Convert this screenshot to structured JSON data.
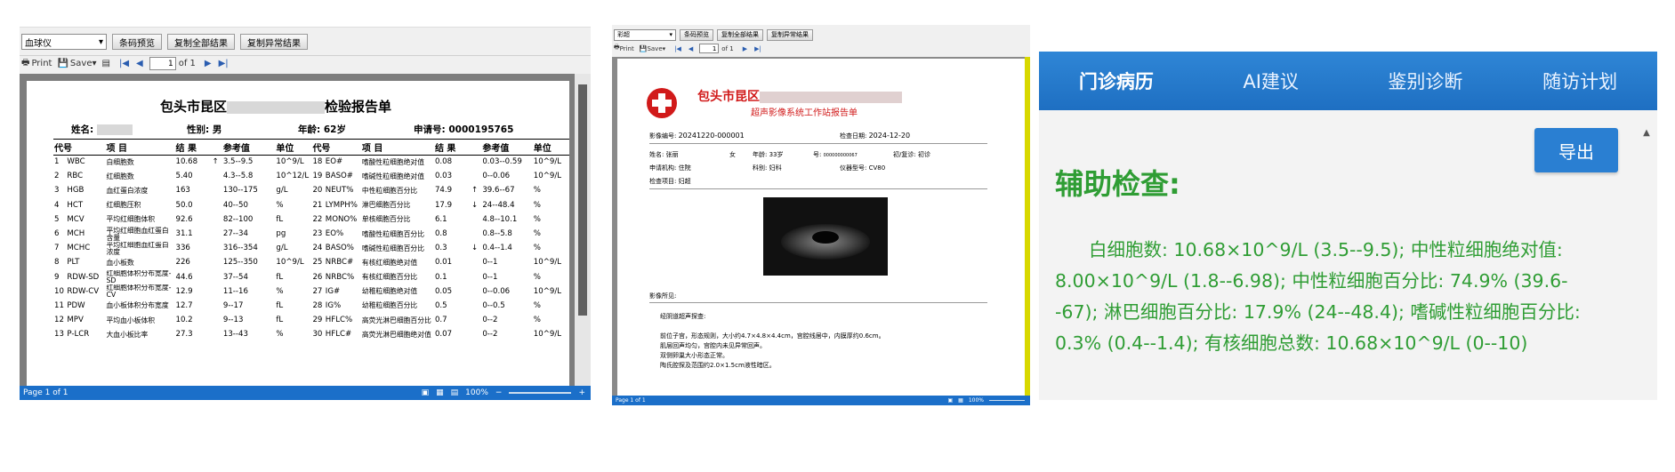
{
  "lab": {
    "toolbar": {
      "instrument": "血球仪",
      "barcode_btn": "条码预览",
      "copy_all_btn": "复制全部结果",
      "copy_abnormal_btn": "复制异常结果"
    },
    "print_bar": {
      "print": "Print",
      "save": "Save",
      "page": "1",
      "of": "of 1"
    },
    "report": {
      "title": "包头市昆区",
      "title_rest": "检验报告单",
      "name_label": "姓名:",
      "gender_label": "性别:",
      "gender": "男",
      "age_label": "年龄:",
      "age": "62岁",
      "req_label": "申请号:",
      "req_no": "0000195765"
    },
    "headers": [
      "代号",
      "项    目",
      "结 果",
      "",
      "参考值",
      "单位",
      "",
      "代号",
      "项    目",
      "结 果",
      "",
      "参考值",
      "单位"
    ],
    "rows": [
      [
        "1",
        "WBC",
        "白细胞数",
        "10.68",
        "↑",
        "3.5--9.5",
        "10^9/L",
        "18",
        "EO#",
        "嗜酸性粒细胞绝对值",
        "0.08",
        "",
        "0.03--0.59",
        "10^9/L"
      ],
      [
        "2",
        "RBC",
        "红细胞数",
        "5.40",
        "",
        "4.3--5.8",
        "10^12/L",
        "19",
        "BASO#",
        "嗜碱性粒细胞绝对值",
        "0.03",
        "",
        "0--0.06",
        "10^9/L"
      ],
      [
        "3",
        "HGB",
        "血红蛋白浓度",
        "163",
        "",
        "130--175",
        "g/L",
        "20",
        "NEUT%",
        "中性粒细胞百分比",
        "74.9",
        "↑",
        "39.6--67",
        "%"
      ],
      [
        "4",
        "HCT",
        "红细胞压积",
        "50.0",
        "",
        "40--50",
        "%",
        "21",
        "LYMPH%",
        "淋巴细胞百分比",
        "17.9",
        "↓",
        "24--48.4",
        "%"
      ],
      [
        "5",
        "MCV",
        "平均红细胞体积",
        "92.6",
        "",
        "82--100",
        "fL",
        "22",
        "MONO%",
        "单核细胞百分比",
        "6.1",
        "",
        "4.8--10.1",
        "%"
      ],
      [
        "6",
        "MCH",
        "平均红细胞血红蛋白含量",
        "31.1",
        "",
        "27--34",
        "pg",
        "23",
        "EO%",
        "嗜酸性粒细胞百分比",
        "0.8",
        "",
        "0.8--5.8",
        "%"
      ],
      [
        "7",
        "MCHC",
        "平均红细胞血红蛋白浓度",
        "336",
        "",
        "316--354",
        "g/L",
        "24",
        "BASO%",
        "嗜碱性粒细胞百分比",
        "0.3",
        "↓",
        "0.4--1.4",
        "%"
      ],
      [
        "8",
        "PLT",
        "血小板数",
        "226",
        "",
        "125--350",
        "10^9/L",
        "25",
        "NRBC#",
        "有核红细胞绝对值",
        "0.01",
        "",
        "0--1",
        "10^9/L"
      ],
      [
        "9",
        "RDW-SD",
        "红细胞体积分布宽度-SD",
        "44.6",
        "",
        "37--54",
        "fL",
        "26",
        "NRBC%",
        "有核红细胞百分比",
        "0.1",
        "",
        "0--1",
        "%"
      ],
      [
        "10",
        "RDW-CV",
        "红细胞体积分布宽度-CV",
        "12.9",
        "",
        "11--16",
        "%",
        "27",
        "IG#",
        "幼稚粒细胞绝对值",
        "0.05",
        "",
        "0--0.06",
        "10^9/L"
      ],
      [
        "11",
        "PDW",
        "血小板体积分布宽度",
        "12.7",
        "",
        "9--17",
        "fL",
        "28",
        "IG%",
        "幼稚粒细胞百分比",
        "0.5",
        "",
        "0--0.5",
        "%"
      ],
      [
        "12",
        "MPV",
        "平均血小板体积",
        "10.2",
        "",
        "9--13",
        "fL",
        "29",
        "HFLC%",
        "高荧光淋巴细胞百分比",
        "0.7",
        "",
        "0--2",
        "%"
      ],
      [
        "13",
        "P-LCR",
        "大血小板比率",
        "27.3",
        "",
        "13--43",
        "%",
        "30",
        "HFLC#",
        "高荧光淋巴细胞绝对值",
        "0.07",
        "",
        "0--2",
        "10^9/L"
      ]
    ],
    "status": "Page 1 of 1",
    "zoom": "100%"
  },
  "ultra": {
    "toolbar": {
      "combo": "彩超",
      "b1": "条码预览",
      "b2": "复制全部结果",
      "b3": "复制异常结果"
    },
    "print_bar": {
      "print": "Print",
      "save": "Save",
      "page": "1",
      "of": "of 1"
    },
    "title": "包头市昆区",
    "subtitle": "超声影像系统工作站报告单",
    "exam_no_label": "影像编号:",
    "exam_no": "20241220-000001",
    "exam_date_label": "检查日期:",
    "exam_date": "2024-12-20",
    "name_label": "姓名:",
    "name": "张丽",
    "gender_label": "女",
    "age_label": "年龄:",
    "age": "33岁",
    "id_label": "号:",
    "id_val": "000000000067",
    "visit_label": "初/复诊:",
    "visit": "初诊",
    "dept_label": "申请机构:",
    "dept": "住院",
    "room_label": "科别:",
    "room": "妇科",
    "device_label": "仪器型号:",
    "device": "CV80",
    "item_label": "检查项目:",
    "item": "妇超",
    "findings_label": "影像所见:",
    "findings": [
      "经阴道超声探查:",
      "前位子宫，形态规则，大小约4.7×4.8×4.4cm，宫腔线居中，内膜厚约0.6cm。",
      "肌层回声均匀，宫腔内未见异常回声。",
      "双侧卵巢大小形态正常。",
      "陶氏腔探及范围约2.0×1.5cm液性暗区。"
    ],
    "status": "Page 1 of 1",
    "zoom": "100%"
  },
  "ai": {
    "tabs": [
      "门诊病历",
      "AI建议",
      "鉴别诊断",
      "随访计划"
    ],
    "export_btn": "导出",
    "heading": "辅助检查:",
    "text": "白细胞数: 10.68×10^9/L (3.5--9.5); 中性粒细胞绝对值: 8.00×10^9/L (1.8--6.98); 中性粒细胞百分比: 74.9% (39.6--67); 淋巴细胞百分比: 17.9% (24--48.4); 嗜碱性粒细胞百分比: 0.3% (0.4--1.4); 有核细胞总数: 10.68×10^9/L (0--10)"
  },
  "colors": {
    "status_blue": "#1b6fc9",
    "title_red": "#d11a1a",
    "tab_blue": "#2a7fd2",
    "text_green": "#2f9d34"
  }
}
